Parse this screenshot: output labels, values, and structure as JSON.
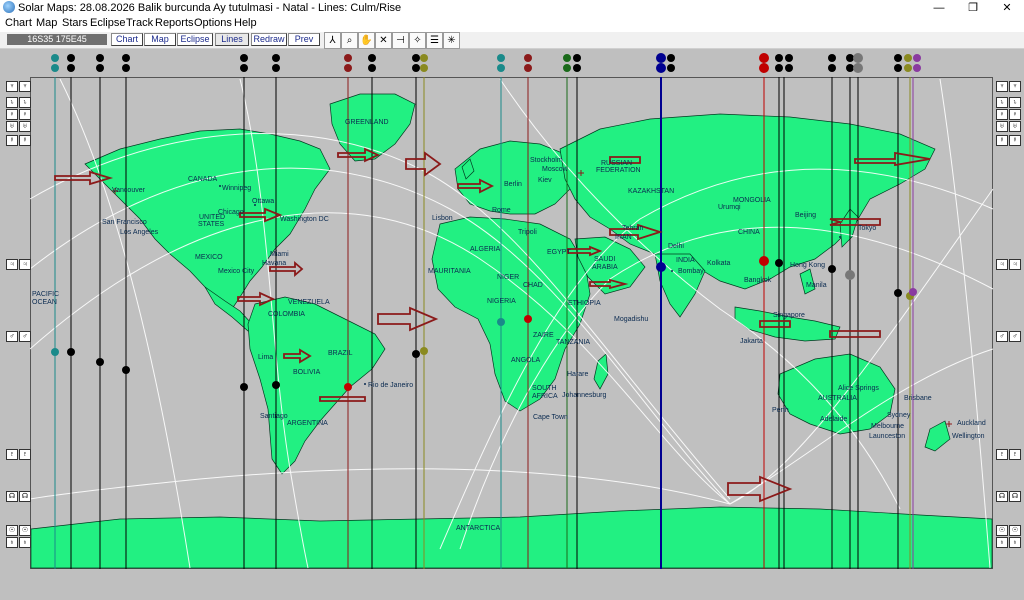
{
  "window": {
    "title": "Solar Maps: 28.08.2026 Balik burcunda Ay tutulmasi - Natal - Lines: Culm/Rise",
    "minimize": "—",
    "maximize": "❐",
    "close": "✕"
  },
  "menu": [
    "Chart",
    "Map",
    "Stars",
    "Eclipse",
    "Track",
    "Reports",
    "Options",
    "Help"
  ],
  "toolbar": {
    "coords": "16S35  175E45",
    "buttons": [
      "Chart",
      "Map",
      "Eclipse",
      "Lines",
      "Redraw",
      "Prev"
    ],
    "icons": [
      "compass-icon",
      "zoom-icon",
      "hand-icon",
      "cross-tool-icon",
      "pin-icon",
      "star-icon",
      "list-icon",
      "grid-icon"
    ]
  },
  "map_labels": [
    "GREENLAND",
    "CANADA",
    "Vancouver",
    "Winnipeg",
    "Ottawa",
    "Chicago",
    "UNITED",
    "STATES",
    "Washington DC",
    "San Francisco",
    "Los Angeles",
    "MEXICO",
    "Mexico City",
    "Miami",
    "Havana",
    "PACIFIC",
    "OCEAN",
    "COLOMBIA",
    "VENEZUELA",
    "Lima",
    "BRAZIL",
    "BOLIVIA",
    "Rio de Janeiro",
    "Santiago",
    "ARGENTINA",
    "Lisbon",
    "ALGERIA",
    "MAURITANIA",
    "NIGER",
    "CHAD",
    "NIGERIA",
    "EGYPT",
    "ETHIOPIA",
    "ZAIRE",
    "TANZANIA",
    "ANGOLA",
    "SOUTH",
    "AFRICA",
    "Harare",
    "Johannesburg",
    "Cape Town",
    "Mogadishu",
    "SAUDI",
    "ARABIA",
    "IRAN",
    "Tehran",
    "Delhi",
    "INDIA",
    "Bombay",
    "RUSSIAN",
    "FEDERATION",
    "KAZAKHSTAN",
    "MONGOLIA",
    "CHINA",
    "Beijing",
    "Tokyo",
    "Urumqi",
    "Kolkata",
    "Hong Kong",
    "Bangkok",
    "Manila",
    "Jakarta",
    "Singapore",
    "Alice Springs",
    "AUSTRALIA",
    "Perth",
    "Adelaide",
    "Sydney",
    "Melbourne",
    "Launceston",
    "Brisbane",
    "Auckland",
    "Wellington",
    "ANTARCTICA",
    "Stockholm",
    "Moscow",
    "Kiev",
    "Berlin",
    "Rome",
    "Tripoli"
  ],
  "colors": {
    "land": "#22f082",
    "ocean": "#c0c0c0",
    "arrow": "#8b1a1a"
  }
}
